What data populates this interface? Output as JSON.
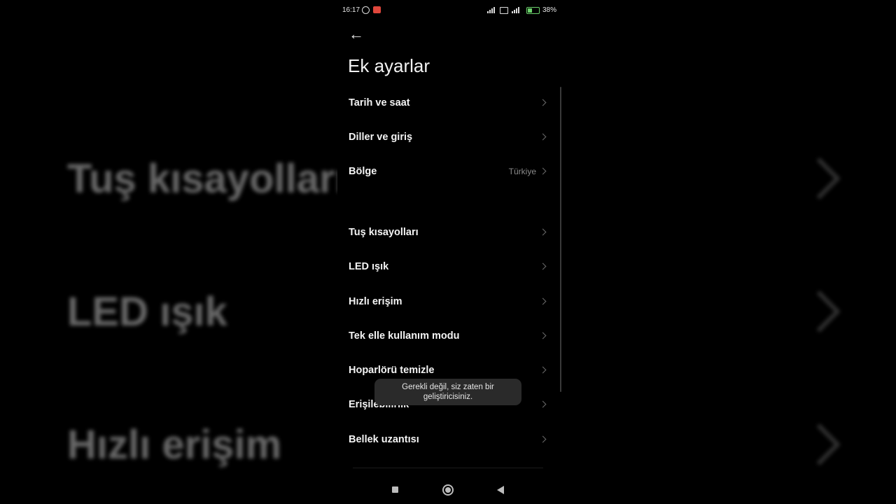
{
  "status_bar": {
    "time": "16:17",
    "battery_percent": "38%",
    "battery_color": "#6cd36c"
  },
  "background": {
    "items": [
      "Tuş kısayolları",
      "LED ışık",
      "Hızlı erişim"
    ]
  },
  "header": {
    "back_icon": "arrow-left-icon",
    "title": "Ek ayarlar"
  },
  "settings": {
    "group1": [
      {
        "label": "Tarih ve saat",
        "value": ""
      },
      {
        "label": "Diller ve giriş",
        "value": ""
      },
      {
        "label": "Bölge",
        "value": "Türkiye"
      }
    ],
    "group2": [
      {
        "label": "Tuş kısayolları"
      },
      {
        "label": "LED ışık"
      },
      {
        "label": "Hızlı erişim"
      },
      {
        "label": "Tek elle kullanım modu"
      },
      {
        "label": "Hoparlörü temizle"
      },
      {
        "label": "Erişilebilirlik"
      },
      {
        "label": "Bellek uzantısı"
      }
    ]
  },
  "toast": {
    "line1": "Gerekli değil, siz zaten bir",
    "line2": "geliştiricisiniz."
  },
  "nav_bar": {
    "recents_icon": "square-icon",
    "home_icon": "circle-icon",
    "back_icon": "triangle-back-icon"
  }
}
